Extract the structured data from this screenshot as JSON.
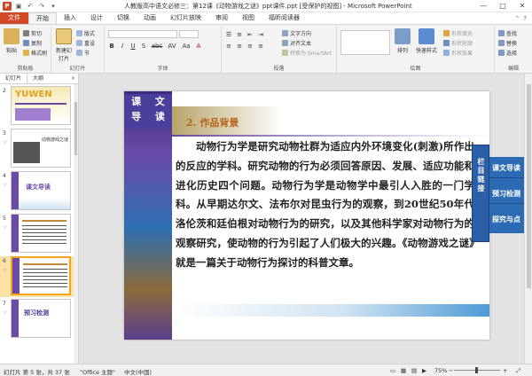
{
  "window": {
    "title": "人教版高中语文必修三：第12课《动物游戏之谜》ppt课件.ppt [受保护的视图] - Microsoft PowerPoint",
    "controls": [
      "—",
      "□",
      "✕"
    ]
  },
  "tabs": [
    "文件",
    "开始",
    "插入",
    "设计",
    "切换",
    "动画",
    "幻灯片放映",
    "审阅",
    "视图",
    "福昕阅读器"
  ],
  "ribbon": {
    "groups": [
      {
        "label": "剪贴板",
        "items": [
          "粘贴",
          "剪切",
          "复制",
          "格式刷"
        ]
      },
      {
        "label": "幻灯片",
        "items": [
          "新建幻灯片",
          "版式",
          "重设",
          "节"
        ]
      },
      {
        "label": "字体",
        "items": [
          "B",
          "I",
          "U",
          "S",
          "abc",
          "AV",
          "Aa",
          "A"
        ]
      },
      {
        "label": "段落",
        "items": [
          "文字方向",
          "对齐文本",
          "转换为 SmartArt"
        ]
      },
      {
        "label": "绘图",
        "items": [
          "排列",
          "快速样式",
          "形状填充",
          "形状轮廓",
          "形状效果"
        ]
      },
      {
        "label": "编辑",
        "items": [
          "查找",
          "替换",
          "选择"
        ]
      }
    ]
  },
  "panel": {
    "tabs": [
      "幻灯片",
      "大纲"
    ],
    "close": "×",
    "slides": [
      {
        "num": "2",
        "caption": "YUWEN"
      },
      {
        "num": "3",
        "caption": "动物游戏之谜"
      },
      {
        "num": "4",
        "caption": "课文导读"
      },
      {
        "num": "5",
        "caption": ""
      },
      {
        "num": "6",
        "caption": ""
      },
      {
        "num": "7",
        "caption": "预习检测"
      }
    ]
  },
  "slide": {
    "title_lines": [
      "课 文",
      "导 读"
    ],
    "heading": "2. 作品背景",
    "body": "动物行为学是研究动物社群为适应内外环境变化(刺激)所作出的反应的学科。研究动物的行为必须回答原因、发展、适应功能和进化历史四个问题。动物行为学是动物学中最引人入胜的一门学科。从早期达尔文、法布尔对昆虫行为的观察，到20世纪50年代洛伦茨和廷伯根对动物行为的研究，以及其他科学家对动物行为的观察研究，使动物的行为引起了人们极大的兴趣。《动物游戏之谜》就是一篇关于动物行为探讨的科普文章。",
    "side_label": "栏目链接",
    "nav_links": [
      "课文导读",
      "预习检测",
      "探究与点"
    ]
  },
  "status": {
    "slide_info": "幻灯片 第 5 张，共 37 张",
    "theme": "\"Office 主题\"",
    "language": "中文(中国)",
    "zoom": "75%"
  },
  "colors": {
    "file_tab": "#d24726",
    "slide_accent": "#4a3f9a",
    "heading": "#b5651d",
    "nav_blue": "#2c6bb3"
  }
}
